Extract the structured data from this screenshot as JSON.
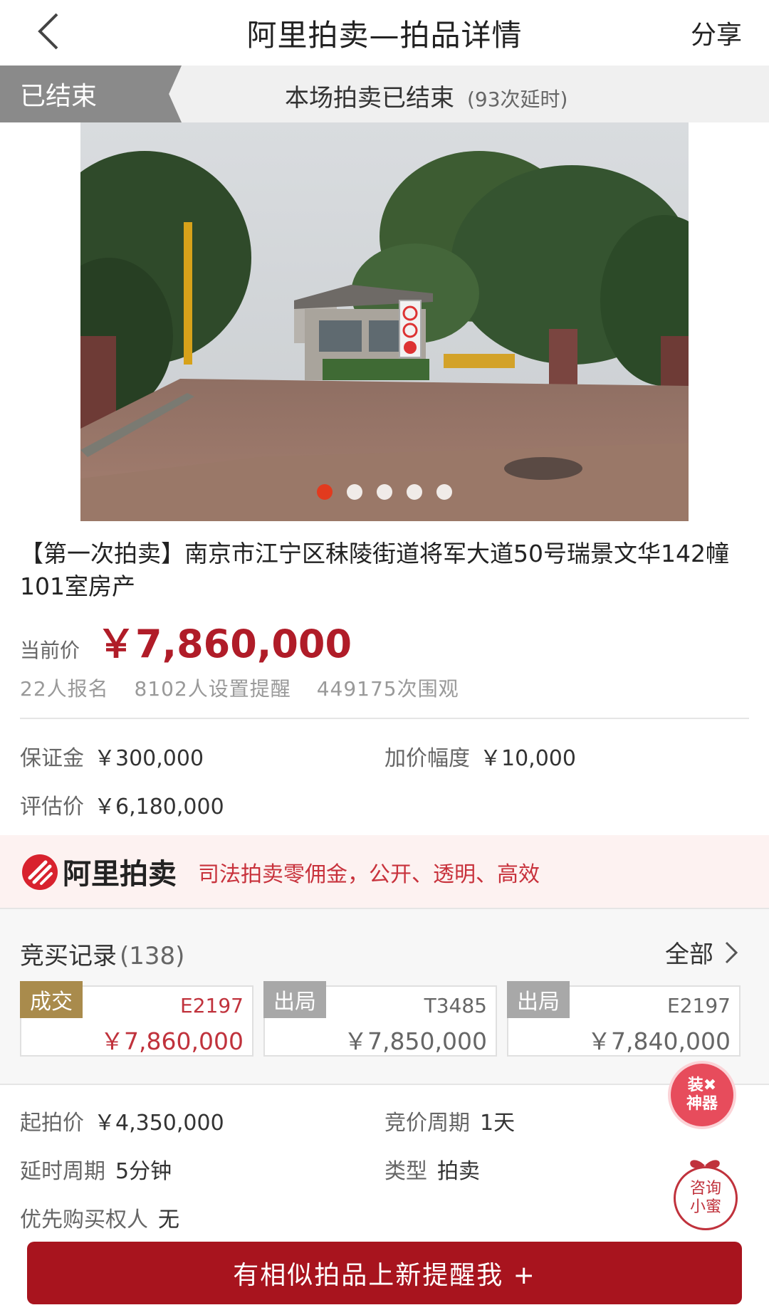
{
  "header": {
    "title": "阿里拍卖—拍品详情",
    "share": "分享"
  },
  "status": {
    "tag": "已结束",
    "text": "本场拍卖已结束",
    "sub": "(93次延时)"
  },
  "item": {
    "title": "【第一次拍卖】南京市江宁区秣陵街道将军大道50号瑞景文华142幢101室房产",
    "price_label": "当前价",
    "price": "￥7,860,000",
    "stats": [
      "22人报名",
      "8102人设置提醒",
      "449175次围观"
    ]
  },
  "details_top": [
    {
      "k": "保证金",
      "v": "￥300,000"
    },
    {
      "k": "加价幅度",
      "v": "￥10,000"
    },
    {
      "k": "评估价",
      "v": "￥6,180,000"
    }
  ],
  "banner": {
    "logo_text": "阿里拍卖",
    "slogan": "司法拍卖零佣金，公开、透明、高效"
  },
  "bids": {
    "title": "竞买记录",
    "count": "(138)",
    "all_label": "全部",
    "records": [
      {
        "tag": "成交",
        "id": "E2197",
        "amount": "￥7,860,000"
      },
      {
        "tag": "出局",
        "id": "T3485",
        "amount": "￥7,850,000"
      },
      {
        "tag": "出局",
        "id": "E2197",
        "amount": "￥7,840,000"
      }
    ]
  },
  "details_bottom": [
    {
      "k": "起拍价",
      "v": "￥4,350,000"
    },
    {
      "k": "竞价周期",
      "v": "1天"
    },
    {
      "k": "延时周期",
      "v": "5分钟"
    },
    {
      "k": "类型",
      "v": "拍卖"
    },
    {
      "k": "优先购买权人",
      "v": "无"
    }
  ],
  "floating": {
    "zhuang": "装✖神器",
    "zixun": "咨询小蜜"
  },
  "footer": {
    "cta": "有相似拍品上新提醒我 +"
  },
  "gallery": {
    "count": 5,
    "active_index": 0
  },
  "colors": {
    "accent": "#b01c28",
    "cta": "#a8141e",
    "won": "#a98b4c",
    "out": "#a8a8a8"
  }
}
